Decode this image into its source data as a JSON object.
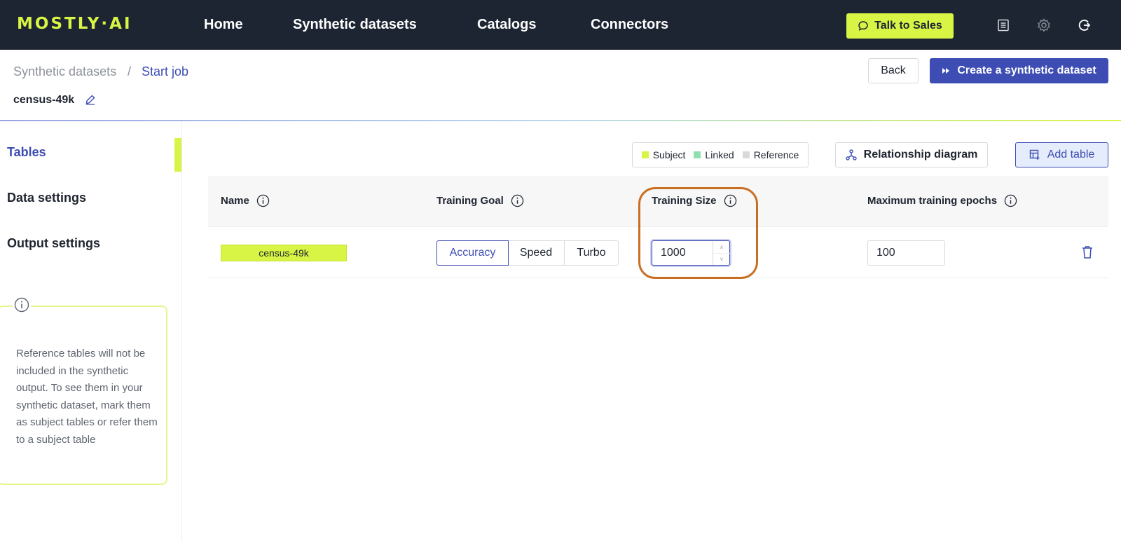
{
  "nav": {
    "logo": "MOSTLY·AI",
    "links": [
      "Home",
      "Synthetic datasets",
      "Catalogs",
      "Connectors"
    ],
    "talk_to_sales": "Talk to Sales",
    "icons": [
      "document-list-icon",
      "gear-icon",
      "logout-icon"
    ]
  },
  "header": {
    "breadcrumb_parent": "Synthetic datasets",
    "breadcrumb_sep": "/",
    "breadcrumb_current": "Start job",
    "dataset_name": "census-49k",
    "back_label": "Back",
    "create_label": "Create a synthetic dataset"
  },
  "sidebar": {
    "items": [
      "Tables",
      "Data settings",
      "Output settings"
    ],
    "active": "Tables",
    "info_text": "Reference tables will not be included in the synthetic output. To see them in your synthetic dataset, mark them as subject tables or refer them to a subject table"
  },
  "legend": {
    "items": [
      {
        "label": "Subject",
        "color": "#d8f545"
      },
      {
        "label": "Linked",
        "color": "#8fe0b0"
      },
      {
        "label": "Reference",
        "color": "#d9d9d9"
      }
    ]
  },
  "toolbar": {
    "relationship_label": "Relationship diagram",
    "add_table_label": "Add table"
  },
  "table": {
    "headers": [
      "Name",
      "Training Goal",
      "Training Size",
      "Maximum training epochs"
    ],
    "rows": [
      {
        "name": "census-49k",
        "training_goal_options": [
          "Accuracy",
          "Speed",
          "Turbo"
        ],
        "training_goal_selected": "Accuracy",
        "training_size": "1000",
        "max_epochs": "100"
      }
    ]
  },
  "colors": {
    "navbar": "#1d2533",
    "accent_lime": "#d8f545",
    "primary_blue": "#3d4db3",
    "highlight_orange": "#c96f23"
  }
}
